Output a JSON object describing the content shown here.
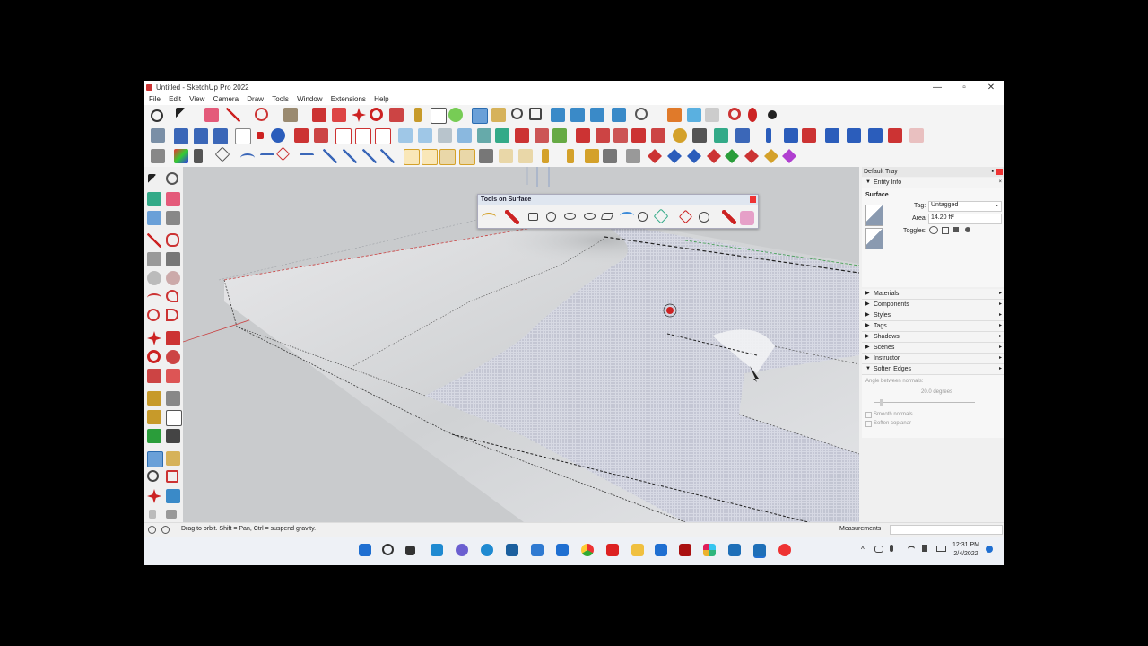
{
  "window": {
    "title": "Untitled - SketchUp Pro 2022"
  },
  "window_controls": {
    "minimize": "—",
    "restore": "▫",
    "close": "✕"
  },
  "menu": [
    "File",
    "Edit",
    "View",
    "Camera",
    "Draw",
    "Tools",
    "Window",
    "Extensions",
    "Help"
  ],
  "tools_on_surface": {
    "title": "Tools on Surface"
  },
  "tray": {
    "title": "Default Tray",
    "entity_info": {
      "header": "Entity Info",
      "entity_type": "Surface",
      "tag_label": "Tag:",
      "tag_value": "Untagged",
      "area_label": "Area:",
      "area_value": "14.20 ft²",
      "toggles_label": "Toggles:"
    },
    "panels": [
      "Materials",
      "Components",
      "Styles",
      "Tags",
      "Shadows",
      "Scenes",
      "Instructor"
    ],
    "soften_edges": {
      "header": "Soften Edges",
      "angle_label": "Angle between normals:",
      "angle_value": "20.0  degrees",
      "smooth_normals": "Smooth normals",
      "soften_coplanar": "Soften coplanar"
    }
  },
  "status": {
    "hint": "Drag to orbit. Shift = Pan, Ctrl = suspend gravity.",
    "measurements_label": "Measurements"
  },
  "taskbar": {
    "time": "12:31 PM",
    "date": "2/4/2022"
  },
  "colors": {
    "accent_red": "#cc2222",
    "accent_blue": "#1f6fd1",
    "accent_green": "#2a9d3a"
  }
}
